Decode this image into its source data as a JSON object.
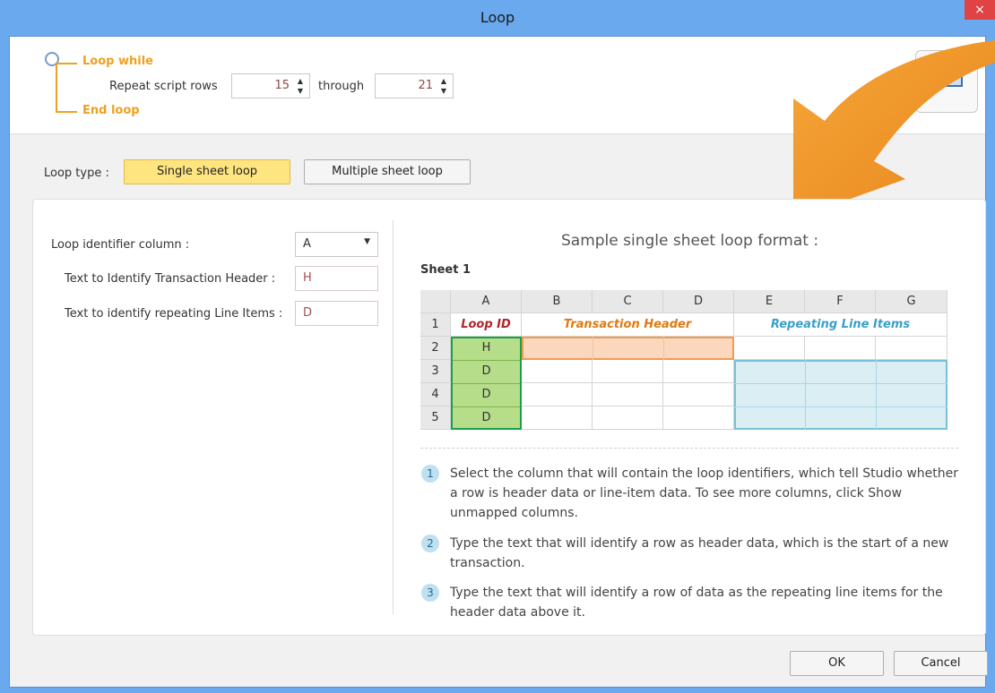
{
  "window": {
    "title": "Loop",
    "close_glyph": "×"
  },
  "loop": {
    "loop_while": "Loop while",
    "end_loop": "End loop",
    "repeat_label": "Repeat script rows",
    "from_value": "15",
    "through_label": "through",
    "to_value": "21"
  },
  "loop_type": {
    "label": "Loop type :",
    "single": "Single sheet loop",
    "multiple": "Multiple sheet loop",
    "selected": "single"
  },
  "form": {
    "identifier_label": "Loop identifier column :",
    "identifier_value": "A",
    "header_label": "Text to Identify Transaction Header :",
    "header_value": "H",
    "line_label": "Text to identify repeating Line Items :",
    "line_value": "D"
  },
  "sample": {
    "title": "Sample single sheet loop format :",
    "sheet": "Sheet 1",
    "columns": [
      "A",
      "B",
      "C",
      "D",
      "E",
      "F",
      "G"
    ],
    "rows": [
      "1",
      "2",
      "3",
      "4",
      "5"
    ],
    "loop_id_label": "Loop ID",
    "transaction_header_label": "Transaction Header",
    "repeating_label": "Repeating Line Items",
    "identifiers": [
      "H",
      "D",
      "D",
      "D"
    ]
  },
  "steps": [
    {
      "num": "1",
      "text": "Select the column that will contain the loop identifiers, which tell Studio whether a row is header data or line-item data. To see more columns, click Show unmapped columns."
    },
    {
      "num": "2",
      "text": " Type the text that will identify a row as header data, which is the start of a new transaction."
    },
    {
      "num": "3",
      "text": "Type the text that will identify a row of data as the repeating line items for the header data above it."
    }
  ],
  "footer": {
    "ok": "OK",
    "cancel": "Cancel"
  },
  "colors": {
    "accent_orange": "#f0a020",
    "loop_id_red": "#b2232a",
    "header_orange": "#e07a10",
    "repeating_blue": "#3aa0c8",
    "selected_button": "#ffe580"
  }
}
